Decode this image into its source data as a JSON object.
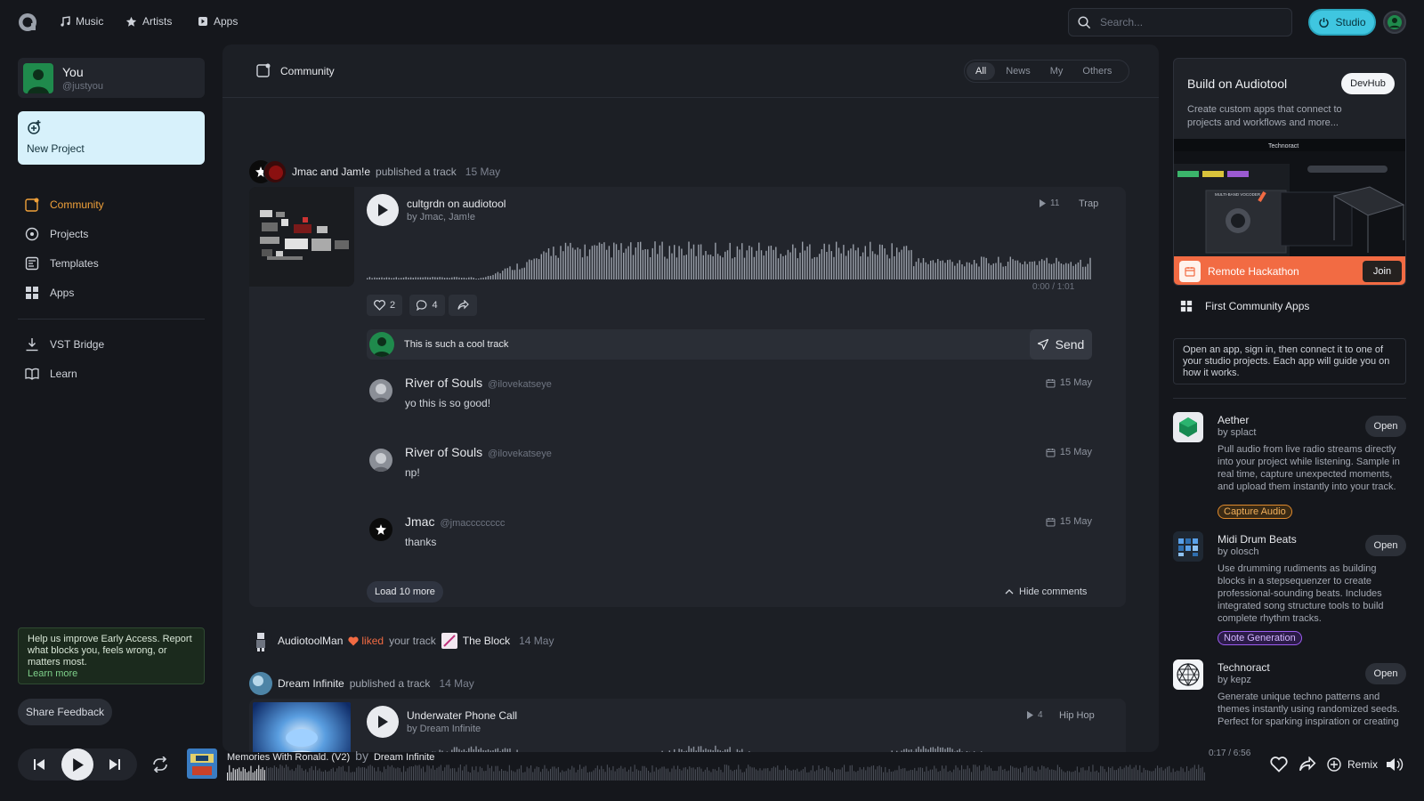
{
  "topbar": {
    "nav": [
      {
        "label": "Music",
        "icon": "music-note-icon"
      },
      {
        "label": "Artists",
        "icon": "star-icon"
      },
      {
        "label": "Apps",
        "icon": "apps-icon"
      }
    ],
    "search_placeholder": "Search...",
    "studio_label": "Studio"
  },
  "user": {
    "name": "You",
    "handle": "@justyou"
  },
  "new_project_label": "New Project",
  "sidebar": {
    "items": [
      {
        "label": "Community",
        "icon": "community-icon",
        "active": true
      },
      {
        "label": "Projects",
        "icon": "projects-icon"
      },
      {
        "label": "Templates",
        "icon": "templates-icon"
      },
      {
        "label": "Apps",
        "icon": "apps-grid-icon"
      }
    ],
    "items2": [
      {
        "label": "VST Bridge",
        "icon": "download-icon"
      },
      {
        "label": "Learn",
        "icon": "book-icon"
      }
    ]
  },
  "feedback": {
    "text": "Help us improve Early Access. Report what blocks you, feels wrong, or matters most.",
    "link": "Learn more",
    "button": "Share Feedback"
  },
  "center": {
    "title": "Community",
    "filters": [
      "All",
      "News",
      "My",
      "Others"
    ],
    "active_filter": "All",
    "post1": {
      "authors": "Jmac and Jam!e",
      "action": "published a track",
      "date": "15 May",
      "track_title": "cultgrdn on audiotool",
      "track_by": "by Jmac, Jam!e",
      "plays": "11",
      "genre": "Trap",
      "time": "0:00 / 1:01",
      "likes": "2",
      "comments_count": "4",
      "comment_input": "This is such a cool track",
      "send_label": "Send",
      "comments": [
        {
          "name": "River of Souls",
          "handle": "@ilovekatseye",
          "date": "15 May",
          "text": "yo this is so good!"
        },
        {
          "name": "River of Souls",
          "handle": "@ilovekatseye",
          "date": "15 May",
          "text": "np!"
        },
        {
          "name": "Jmac",
          "handle": "@jmacccccccc",
          "date": "15 May",
          "text": "thanks"
        }
      ],
      "load_more": "Load 10 more",
      "hide_comments": "Hide comments"
    },
    "post2": {
      "user": "AudiotoolMan",
      "action": "liked",
      "mid": "your track",
      "track": "The Block",
      "date": "14 May"
    },
    "post3": {
      "user": "Dream Infinite",
      "action": "published a track",
      "date": "14 May",
      "track_title": "Underwater Phone Call",
      "track_by": "by Dream Infinite",
      "plays": "4",
      "genre": "Hip Hop"
    }
  },
  "right": {
    "build_title": "Build on Audiotool",
    "devhub": "DevHub",
    "build_desc": "Create custom apps that connect to projects and workflows and more...",
    "preview_label": "Technoract",
    "preview_vocoder": "MULTI-BAND VOCODER",
    "hackathon": "Remote Hackathon",
    "join": "Join",
    "first_apps_title": "First Community Apps",
    "info": "Open an app, sign in, then connect it to one of your studio projects. Each app will guide you on how it works.",
    "apps": [
      {
        "name": "Aether",
        "by": "by splact",
        "desc": "Pull audio from live radio streams directly into your project while listening. Sample in real time, capture unexpected moments, and upload them instantly into your track.",
        "tag": "Capture Audio",
        "tag_color": "#e08a2c",
        "open": "Open"
      },
      {
        "name": "Midi Drum Beats",
        "by": "by olosch",
        "desc": "Use drumming rudiments as building blocks in a stepsequenzer to create professional-sounding beats. Includes integrated song structure tools to build complete rhythm tracks.",
        "tag": "Note Generation",
        "tag_color": "#9c5cf0",
        "open": "Open"
      },
      {
        "name": "Technoract",
        "by": "by kepz",
        "desc": "Generate unique techno patterns and themes instantly using randomized seeds. Perfect for sparking inspiration or creating",
        "open": "Open"
      }
    ]
  },
  "player": {
    "title": "Memories With Ronald. (V2)",
    "by": "by",
    "artist": "Dream Infinite",
    "time": "0:17 / 6:56",
    "remix": "Remix",
    "progress": 0.04
  },
  "colors": {
    "accent": "#f0a13a",
    "studio": "#3fc6e0",
    "hackathon": "#f26b43",
    "liked": "#f26b43"
  }
}
